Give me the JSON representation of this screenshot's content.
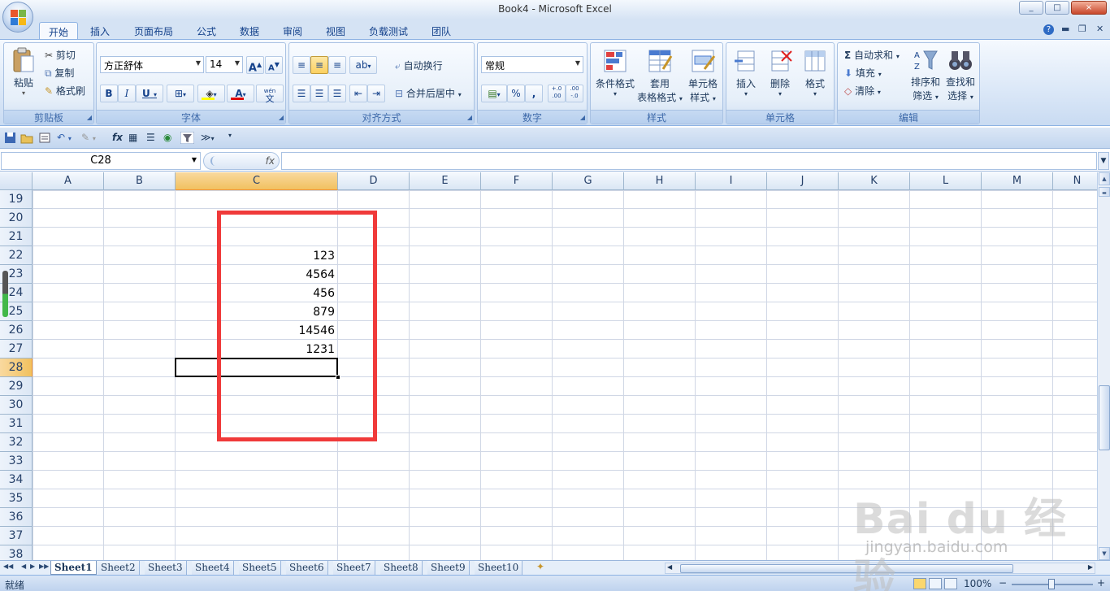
{
  "window": {
    "title": "Book4 - Microsoft Excel",
    "controls": [
      "_",
      "□",
      "×"
    ]
  },
  "tabs": [
    "开始",
    "插入",
    "页面布局",
    "公式",
    "数据",
    "审阅",
    "视图",
    "负载测试",
    "团队"
  ],
  "active_tab": "开始",
  "ribbon": {
    "clipboard": {
      "label": "剪贴板",
      "paste": "粘贴",
      "cut": "剪切",
      "copy": "复制",
      "format_painter": "格式刷"
    },
    "font": {
      "label": "字体",
      "font_name": "方正舒体",
      "font_size": "14",
      "bold": "B",
      "italic": "I",
      "underline": "U",
      "grow": "A",
      "shrink": "A",
      "wen": "文",
      "wen_top": "wén"
    },
    "alignment": {
      "label": "对齐方式",
      "wrap_text": "自动换行",
      "merge_center": "合并后居中"
    },
    "number": {
      "label": "数字",
      "format": "常规",
      "percent": "%",
      "comma": ",",
      "inc_decimal": "←.0\n.00",
      "dec_decimal": ".00\n→.0"
    },
    "styles": {
      "label": "样式",
      "conditional_l1": "条件格式",
      "table_l1": "套用",
      "table_l2": "表格格式",
      "cell_styles_l1": "单元格",
      "cell_styles_l2": "样式"
    },
    "cells": {
      "label": "单元格",
      "insert": "插入",
      "delete": "删除",
      "format": "格式"
    },
    "editing": {
      "label": "编辑",
      "autosum": "自动求和",
      "fill": "填充",
      "clear": "清除",
      "sort_l1": "排序和",
      "sort_l2": "筛选",
      "find_l1": "查找和",
      "find_l2": "选择",
      "sigma": "Σ"
    }
  },
  "formula_bar": {
    "name_box": "C28",
    "fx": "fx",
    "formula": ""
  },
  "columns": [
    "A",
    "B",
    "C",
    "D",
    "E",
    "F",
    "G",
    "H",
    "I",
    "J",
    "K",
    "L",
    "M",
    "N"
  ],
  "selected_column": "C",
  "rows": [
    "19",
    "20",
    "21",
    "22",
    "23",
    "24",
    "25",
    "26",
    "27",
    "28",
    "29",
    "30",
    "31",
    "32",
    "33",
    "34",
    "35",
    "36",
    "37",
    "38"
  ],
  "selected_row": "28",
  "cell_values": [
    {
      "ref": "C22",
      "value": "123"
    },
    {
      "ref": "C23",
      "value": "4564"
    },
    {
      "ref": "C24",
      "value": "456"
    },
    {
      "ref": "C25",
      "value": "879"
    },
    {
      "ref": "C26",
      "value": "14546"
    },
    {
      "ref": "C27",
      "value": "1231"
    }
  ],
  "sheets": [
    "Sheet1",
    "Sheet2",
    "Sheet3",
    "Sheet4",
    "Sheet5",
    "Sheet6",
    "Sheet7",
    "Sheet8",
    "Sheet9",
    "Sheet10"
  ],
  "active_sheet": "Sheet1",
  "status": {
    "ready": "就绪",
    "zoom": "100%",
    "zoom_minus": "−",
    "zoom_plus": "+"
  },
  "watermark": {
    "main": "Bai du 经验",
    "sub": "jingyan.baidu.com"
  },
  "colors": {
    "highlight_box": "#f03a3a",
    "selection_header": "#f1c15f",
    "ribbon_blue": "#dde9f8"
  }
}
